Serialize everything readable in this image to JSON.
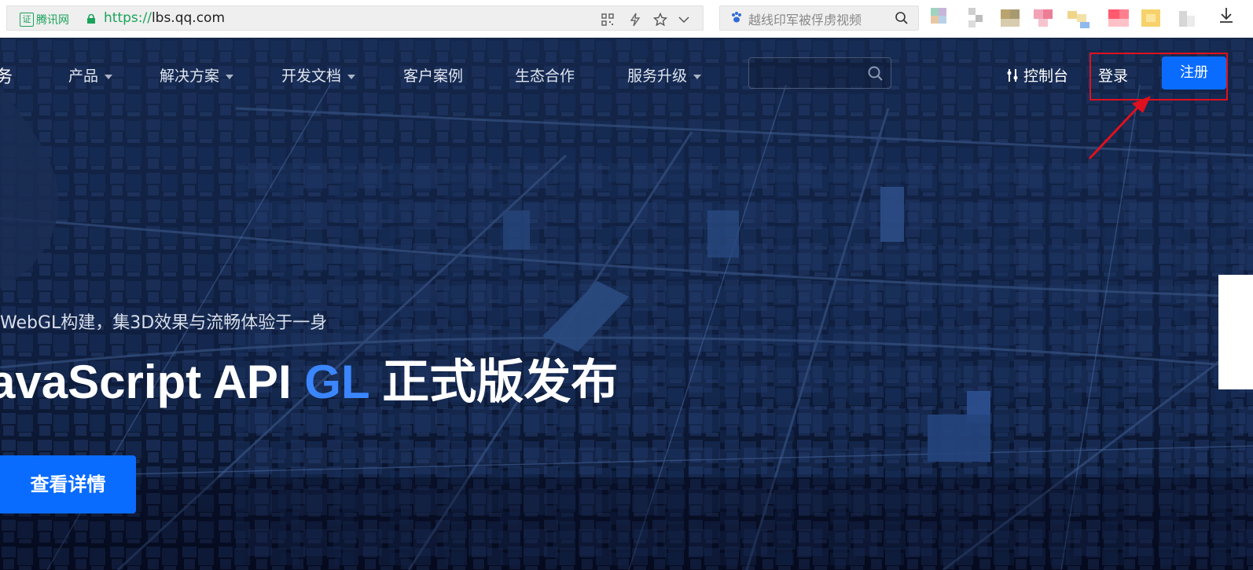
{
  "browser": {
    "cert_label": "证",
    "cert_name": "腾讯网",
    "url_scheme": "https://",
    "url_host": "lbs.qq.com",
    "search_placeholder": "越线印军被俘虏视频",
    "icons": [
      "qr-code-icon",
      "lightning-icon",
      "star-icon",
      "chevron-down-icon",
      "paw-icon",
      "search-icon",
      "download-icon"
    ]
  },
  "nav": {
    "logo_fragment": "务",
    "items": [
      {
        "label": "产品",
        "has_dropdown": true
      },
      {
        "label": "解决方案",
        "has_dropdown": true
      },
      {
        "label": "开发文档",
        "has_dropdown": true
      },
      {
        "label": "客户案例",
        "has_dropdown": false
      },
      {
        "label": "生态合作",
        "has_dropdown": false
      },
      {
        "label": "服务升级",
        "has_dropdown": true
      }
    ],
    "console_label": "控制台",
    "login_label": "登录",
    "register_label": "注册"
  },
  "hero": {
    "subtitle": "WebGL构建，集3D效果与流畅体验于一身",
    "headline_prefix": "avaScript API ",
    "headline_highlight": "GL",
    "headline_suffix": " 正式版发布",
    "cta_label": "查看详情"
  },
  "colors": {
    "accent": "#0a6cff",
    "highlight": "#3b86ff",
    "annotation": "#e0101e",
    "url_green": "#1aa35b"
  }
}
